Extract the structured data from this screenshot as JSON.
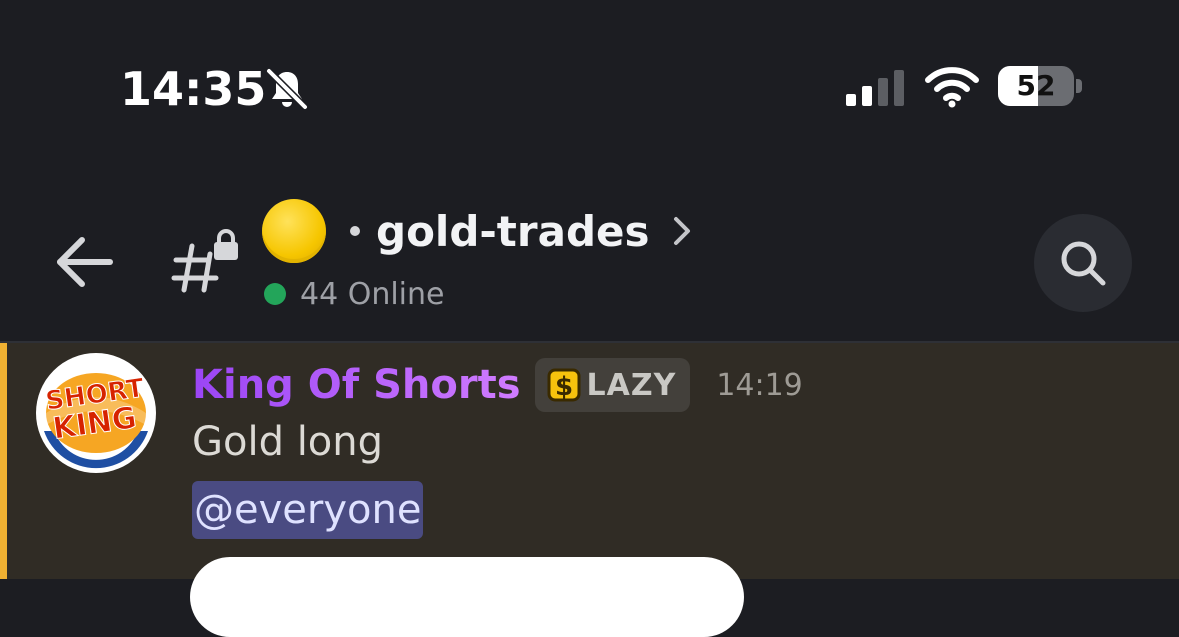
{
  "status_bar": {
    "time": "14:35",
    "battery_level": "52",
    "battery_fraction": 0.52,
    "icons": [
      "bell-slash-icon",
      "cellular-signal-icon",
      "wifi-icon",
      "battery-icon"
    ]
  },
  "header": {
    "channel_name": "gold-trades",
    "online_count": "44 Online",
    "icons": [
      "back-arrow-icon",
      "locked-hash-icon",
      "yellow-circle-emoji",
      "chevron-right-icon",
      "search-icon"
    ]
  },
  "message": {
    "author": "King Of Shorts",
    "tag_label": "LAZY",
    "timestamp": "14:19",
    "text": "Gold long",
    "mention": "@everyone",
    "avatar_text_top": "SHORT",
    "avatar_text_bottom": "KING"
  },
  "colors": {
    "background": "#1c1d22",
    "message_highlight": "#302c25",
    "mention_bar": "#f0b132",
    "online_green": "#23a55a",
    "author_gradient_start": "#9b45f5",
    "author_gradient_end": "#d07cff",
    "mention_bg": "#4a4b82"
  }
}
